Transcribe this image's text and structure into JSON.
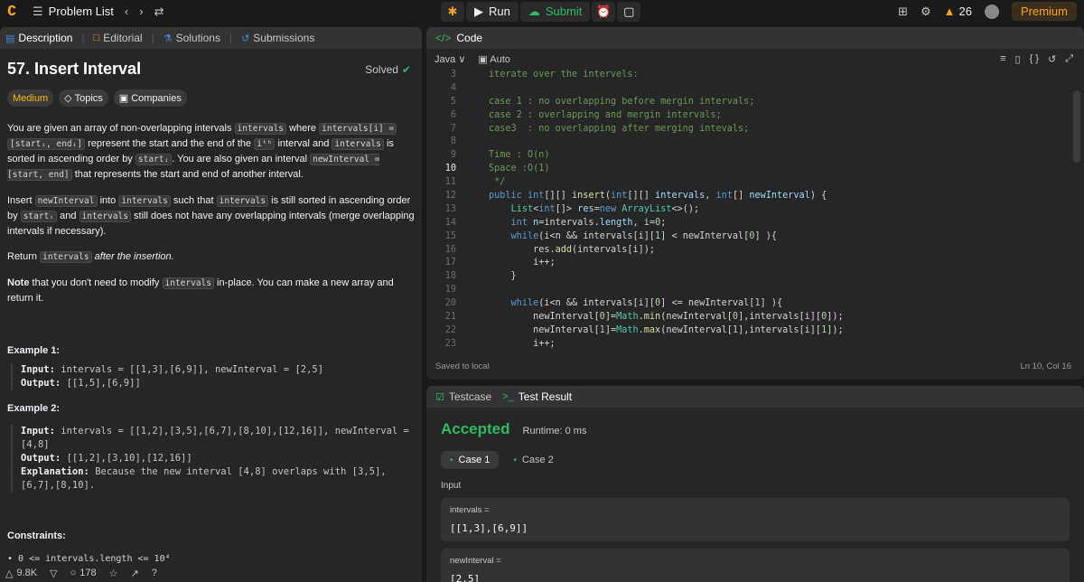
{
  "topbar": {
    "problem_list": "Problem List",
    "run": "Run",
    "submit": "Submit",
    "streak": "26",
    "premium": "Premium"
  },
  "tabs": [
    "Description",
    "Editorial",
    "Solutions",
    "Submissions"
  ],
  "problem": {
    "title": "57. Insert Interval",
    "status": "Solved",
    "difficulty": "Medium",
    "topics": "Topics",
    "companies": "Companies"
  },
  "description": {
    "p1_a": "You are given an array of non-overlapping intervals",
    "p1_code1": "intervals",
    "p1_b": "where",
    "p1_code2": "intervals[i] =",
    "p1_code3": "[startᵢ, endᵢ]",
    "p1_c": "represent the start and the end of the",
    "p1_ith": "iᵗʰ",
    "p1_d": "interval and",
    "p1_code4": "intervals",
    "p1_e": "is sorted in ascending order by",
    "p1_code5": "startᵢ",
    "p1_f": ". You are also given an interval",
    "p1_code6": "newInterval = [start, end]",
    "p1_g": "that represents the start and end of another interval.",
    "p2_a": "Insert",
    "p2_code1": "newInterval",
    "p2_b": "into",
    "p2_code2": "intervals",
    "p2_c": "such that",
    "p2_code3": "intervals",
    "p2_d": "is still sorted in ascending order by",
    "p2_code4": "startᵢ",
    "p2_e": "and",
    "p2_code5": "intervals",
    "p2_f": "still does not have any overlapping intervals (merge overlapping intervals if necessary).",
    "p3_a": "Return",
    "p3_code": "intervals",
    "p3_b": "after the insertion.",
    "p4_a": "Note",
    "p4_b": "that you don't need to modify",
    "p4_code": "intervals",
    "p4_c": "in-place. You can make a new array and return it."
  },
  "examples": [
    {
      "title": "Example 1:",
      "input_label": "Input:",
      "input": "intervals = [[1,3],[6,9]], newInterval = [2,5]",
      "output_label": "Output:",
      "output": "[[1,5],[6,9]]"
    },
    {
      "title": "Example 2:",
      "input_label": "Input:",
      "input_1": "intervals = [[1,2],[3,5],[6,7],[8,10],[12,16]], newInterval =",
      "input_2": "[4,8]",
      "output_label": "Output:",
      "output": "[[1,2],[3,10],[12,16]]",
      "explanation_label": "Explanation:",
      "explanation_1": "Because the new interval [4,8] overlaps with [3,5],",
      "explanation_2": "[6,7],[8,10]."
    }
  ],
  "constraints": {
    "title": "Constraints:",
    "item": "0 <= intervals.length <= 10⁴"
  },
  "footer": {
    "likes": "9.8K",
    "comments": "178"
  },
  "editor": {
    "title": "Code",
    "language": "Java",
    "auto": "Auto",
    "status": "Saved to local",
    "cursor": "Ln 10, Col 16",
    "current_line": 10
  },
  "results": {
    "testcase_tab": "Testcase",
    "result_tab": "Test Result",
    "verdict": "Accepted",
    "runtime": "Runtime: 0 ms",
    "cases": [
      "Case 1",
      "Case 2"
    ],
    "input_label": "Input",
    "params": [
      {
        "name": "intervals =",
        "value": "[[1,3],[6,9]]"
      },
      {
        "name": "newInterval =",
        "value": "[2,5]"
      }
    ]
  },
  "colors": {
    "accent_green": "#2cbb5d",
    "accent_orange": "#ffa116",
    "medium": "#ffb800"
  },
  "icons": [
    "logo-icon",
    "list-icon",
    "chevron-left-icon",
    "chevron-right-icon",
    "shuffle-icon",
    "debug-icon",
    "play-icon",
    "upload-icon",
    "alarm-icon",
    "note-icon",
    "layout-icon",
    "gear-icon",
    "fire-icon"
  ]
}
